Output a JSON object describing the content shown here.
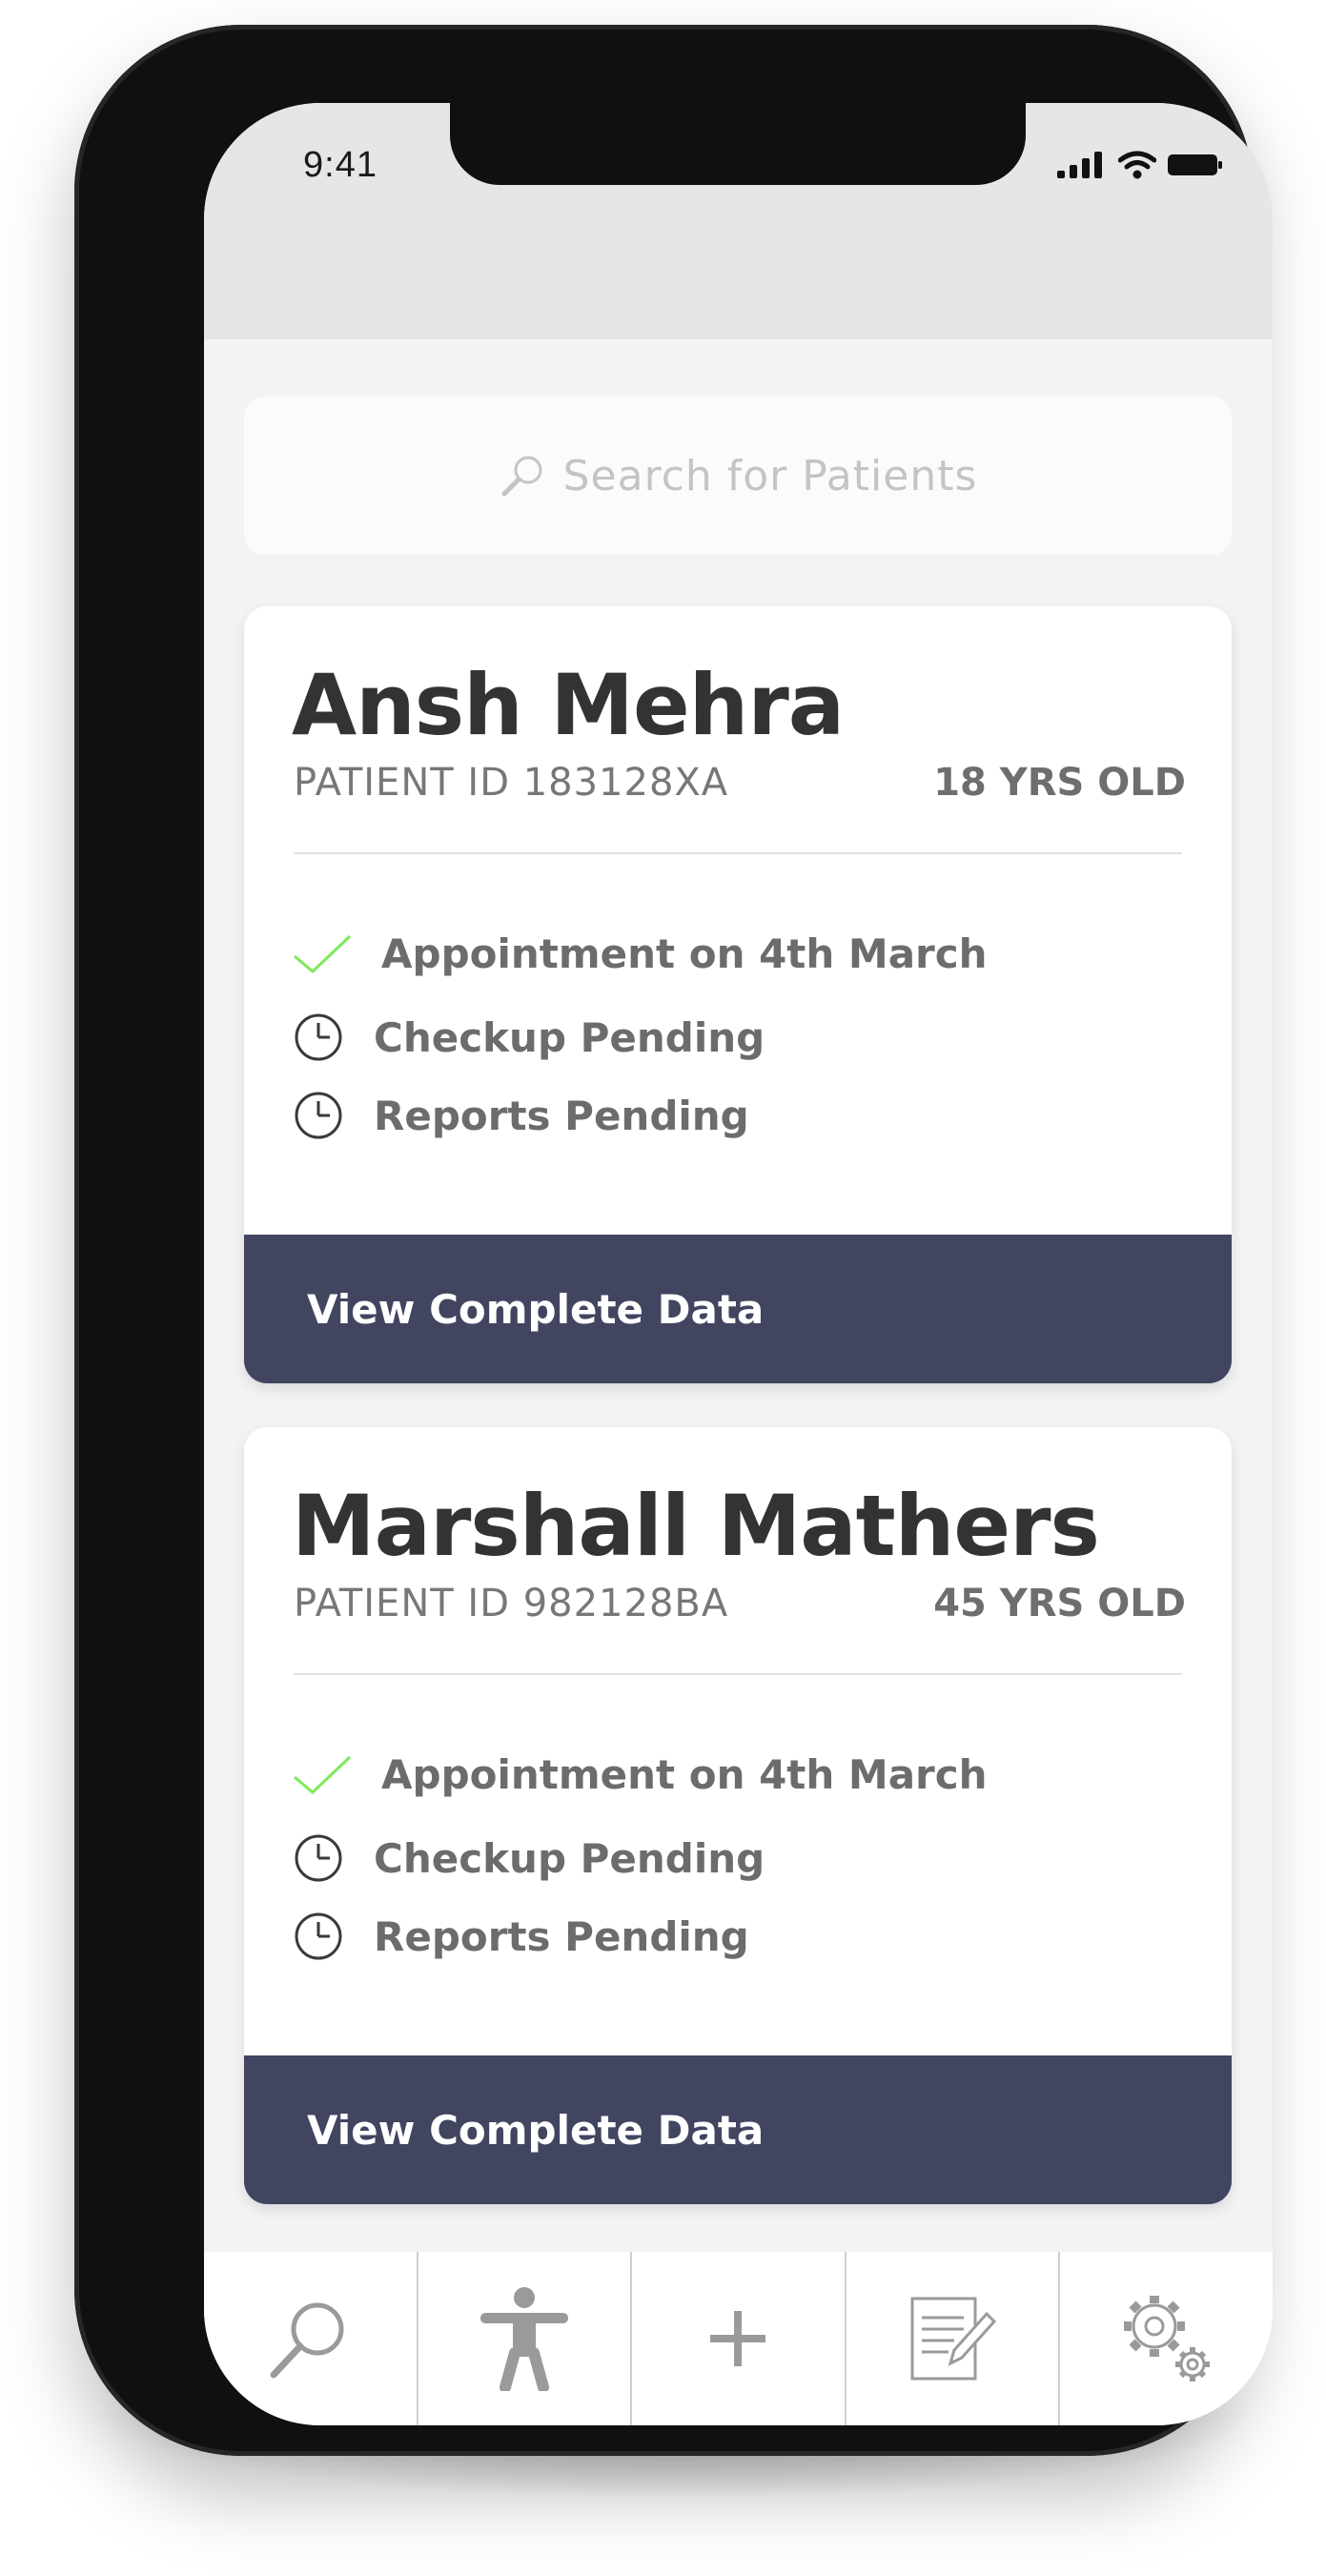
{
  "status_bar": {
    "time": "9:41"
  },
  "search": {
    "placeholder": "Search for Patients"
  },
  "patients": [
    {
      "name": "Ansh Mehra",
      "patient_id": "PATIENT ID 183128XA",
      "age": "18 YRS OLD",
      "statuses": [
        {
          "icon": "check-icon",
          "label": "Appointment on 4th March"
        },
        {
          "icon": "clock-icon",
          "label": "Checkup Pending"
        },
        {
          "icon": "clock-icon",
          "label": "Reports Pending"
        }
      ],
      "action_label": "View Complete Data"
    },
    {
      "name": "Marshall Mathers",
      "patient_id": "PATIENT ID 982128BA",
      "age": "45 YRS OLD",
      "statuses": [
        {
          "icon": "check-icon",
          "label": "Appointment on 4th March"
        },
        {
          "icon": "clock-icon",
          "label": "Checkup Pending"
        },
        {
          "icon": "clock-icon",
          "label": "Reports Pending"
        }
      ],
      "action_label": "View Complete Data"
    }
  ],
  "tab_bar": {
    "tabs": [
      {
        "icon": "search-icon"
      },
      {
        "icon": "person-icon"
      },
      {
        "icon": "plus-icon"
      },
      {
        "icon": "edit-document-icon"
      },
      {
        "icon": "gear-icon"
      }
    ]
  },
  "colors": {
    "action_bar": "#414560",
    "check": "#7dea5a",
    "screen_bg": "#f3f3f4",
    "header_bg": "#e6e5e7"
  }
}
